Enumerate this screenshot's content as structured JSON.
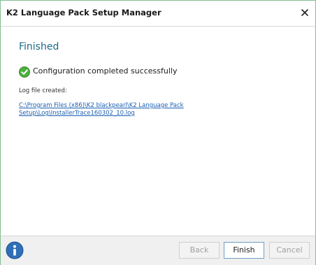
{
  "window": {
    "title": "K2 Language Pack Setup Manager"
  },
  "content": {
    "heading": "Finished",
    "status_message": "Configuration completed successfully",
    "log_label": "Log file created:",
    "log_path": "C:\\Program Files (x86)\\K2 blackpearl\\K2 Language Pack Setup\\Log\\InstallerTrace160302_10.log"
  },
  "footer": {
    "back_label": "Back",
    "finish_label": "Finish",
    "cancel_label": "Cancel"
  },
  "icons": {
    "close": "close-icon",
    "success": "check-circle-icon",
    "info": "info-icon"
  },
  "colors": {
    "heading": "#1d6a88",
    "link": "#1b5fb3",
    "success": "#4caf3f",
    "info": "#2f6fb7"
  }
}
